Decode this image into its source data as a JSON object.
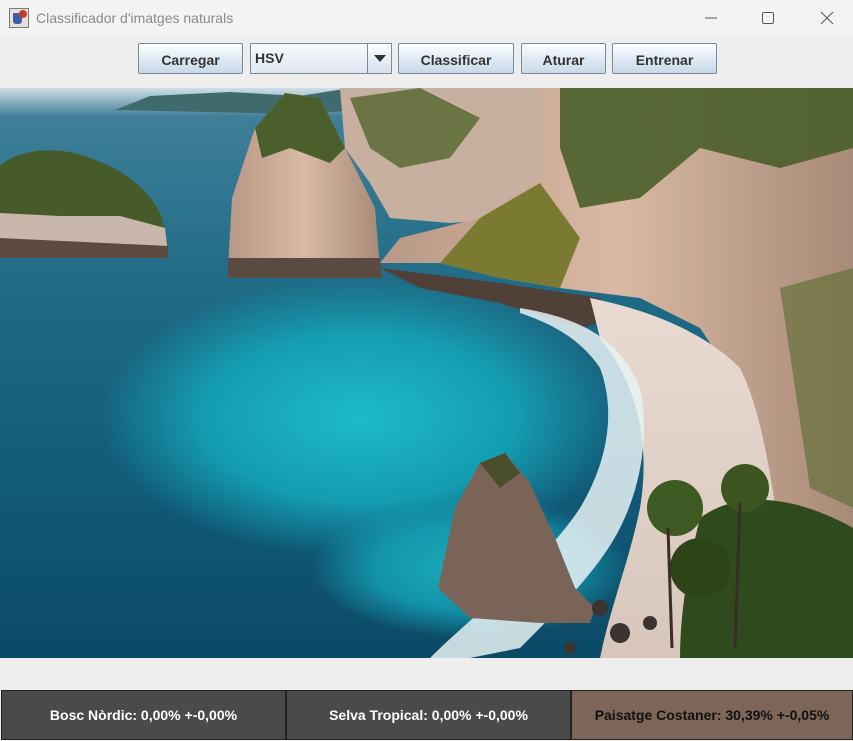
{
  "window": {
    "title": "Classificador d'imatges naturals",
    "controls": {
      "minimize_icon": "minimize-icon",
      "maximize_icon": "maximize-icon",
      "close_icon": "close-icon"
    }
  },
  "toolbar": {
    "load_label": "Carregar",
    "color_space": {
      "selected": "HSV"
    },
    "classify_label": "Classificar",
    "stop_label": "Aturar",
    "train_label": "Entrenar"
  },
  "results": [
    {
      "label": "Bosc Nòrdic: 0,00% +-0,00%",
      "color": "#4a4a4a"
    },
    {
      "label": "Selva Tropical: 0,00% +-0,00%",
      "color": "#4a4a4a"
    },
    {
      "label": "Paisatge Costaner: 30,39% +-0,05%",
      "color": "#7d6657"
    }
  ],
  "colors": {
    "button_gradient_top": "#fdfeff",
    "button_gradient_bottom": "#c9d9ea",
    "panel_dark": "#4a4a4a",
    "panel_highlight": "#7d6657"
  }
}
